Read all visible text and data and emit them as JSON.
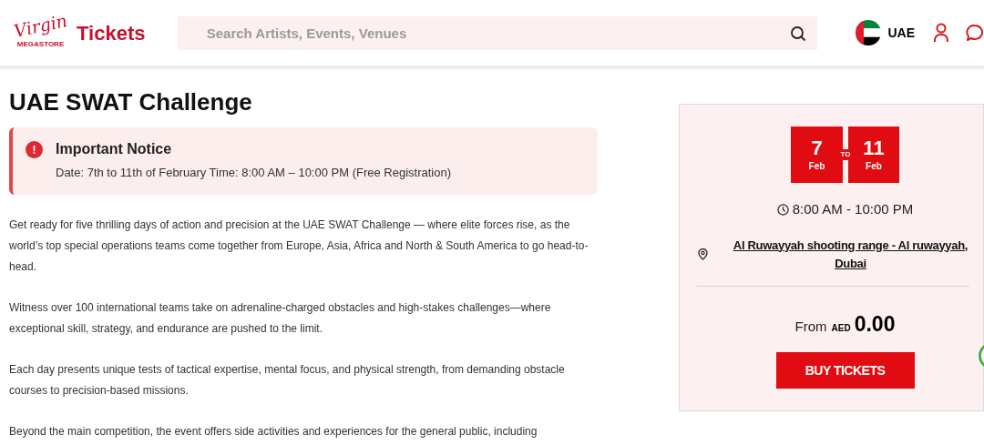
{
  "header": {
    "logo": {
      "script": "Virgin",
      "sub": "MEGASTORE",
      "word": "Tickets"
    },
    "search": {
      "placeholder": "Search Artists, Events, Venues"
    },
    "country": "UAE"
  },
  "title": "UAE SWAT Challenge",
  "notice": {
    "icon": "!",
    "heading": "Important Notice",
    "text": "Date: 7th to 11th of February Time: 8:00 AM – 10:00 PM (Free Registration)"
  },
  "paragraphs": [
    "Get ready for five thrilling days of action and precision at the UAE SWAT Challenge — where elite forces rise, as the world’s top special operations teams come together from Europe, Asia, Africa and North & South America to go head-to-head.",
    "Witness over 100 international teams take on adrenaline-charged obstacles and high-stakes challenges—where exceptional skill, strategy, and endurance are pushed to the limit.",
    "Each day presents unique tests of tactical expertise, mental focus, and physical strength, from demanding obstacle courses to precision-based missions.",
    "Beyond the main competition, the event offers side activities and experiences for the general public, including"
  ],
  "booking": {
    "start": {
      "day": "7",
      "month": "Feb"
    },
    "separator": "TO",
    "end": {
      "day": "11",
      "month": "Feb"
    },
    "time": "8:00 AM - 10:00 PM",
    "venue": "Al Ruwayyah shooting range - Al ruwayyah, Dubai",
    "price_prefix": "From",
    "currency": "AED",
    "price": "0.00",
    "button": "BUY TICKETS"
  }
}
